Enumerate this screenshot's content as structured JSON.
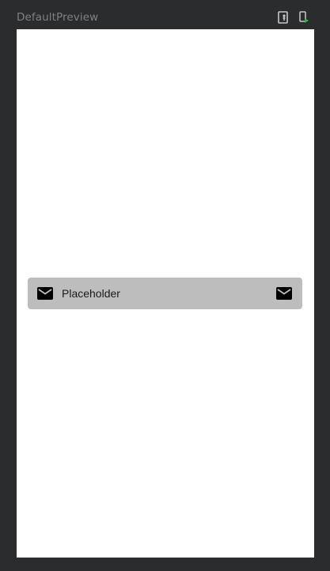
{
  "preview": {
    "title": "DefaultPreview"
  },
  "toolbar": {
    "icons": [
      "interactive-mode-icon",
      "deploy-to-device-icon"
    ]
  },
  "text_field": {
    "placeholder": "Placeholder",
    "leading_icon": "mail-icon",
    "trailing_icon": "mail-icon",
    "background_color": "#bdbdbd"
  },
  "colors": {
    "ide_background": "#2b2c2e",
    "canvas_background": "#ffffff",
    "title_text": "#7f8185",
    "run_accent": "#3cb054"
  }
}
